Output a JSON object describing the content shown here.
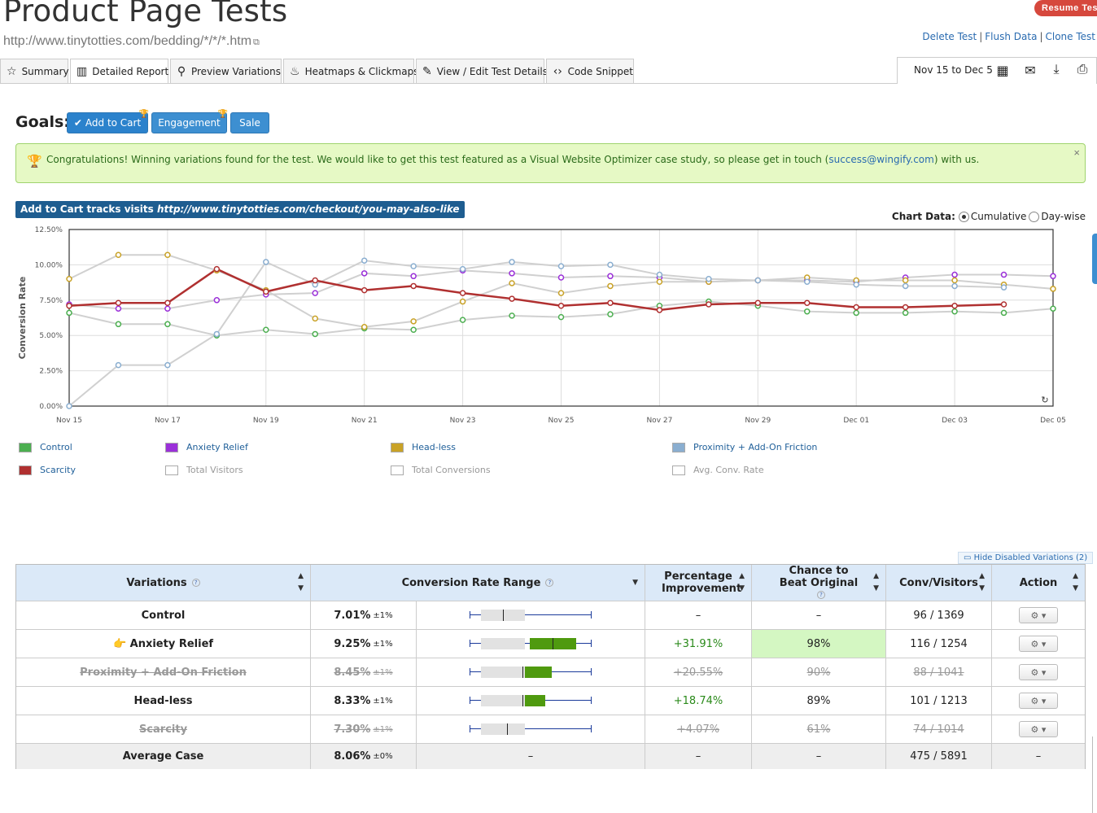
{
  "header": {
    "title": "Product Page Tests",
    "url": "http://www.tinytotties.com/bedding/*/*/*.htm",
    "resume_label": "Resume Test",
    "links": [
      "Delete Test",
      "Flush Data",
      "Clone Test"
    ]
  },
  "tabs": [
    {
      "label": "Summary",
      "icon": "star-icon"
    },
    {
      "label": "Detailed Report",
      "icon": "bar-chart-icon"
    },
    {
      "label": "Preview Variations",
      "icon": "search-icon"
    },
    {
      "label": "Heatmaps & Clickmaps",
      "icon": "flame-icon"
    },
    {
      "label": "View / Edit Test Details",
      "icon": "wrench-icon"
    },
    {
      "label": "Code Snippet",
      "icon": "code-icon"
    }
  ],
  "date_range": "Nov 15 to Dec 5",
  "goals": {
    "label": "Goals:",
    "buttons": [
      "Add to Cart",
      "Engagement",
      "Sale"
    ]
  },
  "alert": {
    "text_before": "Congratulations! Winning variations found for the test. We would like to get this test featured as a Visual Website Optimizer case study, so please get in touch (",
    "email": "success@wingify.com",
    "text_after": ") with us.",
    "close": "×"
  },
  "chart_header": {
    "prefix": "Add to Cart tracks visits ",
    "url": "http://www.tinytotties.com/checkout/you-may-also-like"
  },
  "chart_options": {
    "label": "Chart Data:",
    "cumulative": "Cumulative",
    "daywise": "Day-wise"
  },
  "chart_data": {
    "type": "line",
    "ylabel": "Conversion Rate",
    "ylim": [
      0,
      12.5
    ],
    "yticks": [
      "0.00%",
      "2.50%",
      "5.00%",
      "7.50%",
      "10.00%",
      "12.50%"
    ],
    "xtick_labels": [
      "Nov 15",
      "Nov 17",
      "Nov 19",
      "Nov 21",
      "Nov 23",
      "Nov 25",
      "Nov 27",
      "Nov 29",
      "Dec 01",
      "Dec 03",
      "Dec 05"
    ],
    "x": [
      "Nov 15",
      "Nov 16",
      "Nov 17",
      "Nov 18",
      "Nov 19",
      "Nov 20",
      "Nov 21",
      "Nov 22",
      "Nov 23",
      "Nov 24",
      "Nov 25",
      "Nov 26",
      "Nov 27",
      "Nov 28",
      "Nov 29",
      "Nov 30",
      "Dec 01",
      "Dec 02",
      "Dec 03",
      "Dec 04",
      "Dec 05"
    ],
    "series": [
      {
        "name": "Control",
        "color": "#4caf50",
        "values": [
          6.6,
          5.8,
          5.8,
          5.0,
          5.4,
          5.1,
          5.5,
          5.4,
          6.1,
          6.4,
          6.3,
          6.5,
          7.1,
          7.4,
          7.1,
          6.7,
          6.6,
          6.6,
          6.7,
          6.6,
          6.9
        ]
      },
      {
        "name": "Anxiety Relief",
        "color": "#9b30d9",
        "values": [
          7.2,
          6.9,
          6.9,
          7.5,
          7.9,
          8.0,
          9.4,
          9.2,
          9.6,
          9.4,
          9.1,
          9.2,
          9.1,
          8.8,
          8.9,
          8.9,
          8.8,
          9.1,
          9.3,
          9.3,
          9.2
        ]
      },
      {
        "name": "Head-less",
        "color": "#c9a227",
        "values": [
          9.0,
          10.7,
          10.7,
          9.6,
          8.2,
          6.2,
          5.6,
          6.0,
          7.4,
          8.7,
          8.0,
          8.5,
          8.8,
          8.8,
          8.9,
          9.1,
          8.9,
          8.9,
          8.9,
          8.6,
          8.3
        ]
      },
      {
        "name": "Proximity + Add-On Friction",
        "color": "#8aaed0",
        "values": [
          0.0,
          2.9,
          2.9,
          5.1,
          10.2,
          8.6,
          10.3,
          9.9,
          9.7,
          10.2,
          9.9,
          10.0,
          9.3,
          9.0,
          8.9,
          8.8,
          8.6,
          8.5,
          8.5,
          8.4,
          null
        ]
      },
      {
        "name": "Scarcity",
        "color": "#b03030",
        "values": [
          7.1,
          7.3,
          7.3,
          9.7,
          8.1,
          8.9,
          8.2,
          8.5,
          8.0,
          7.6,
          7.1,
          7.3,
          6.8,
          7.2,
          7.3,
          7.3,
          7.0,
          7.0,
          7.1,
          7.2,
          null
        ]
      }
    ]
  },
  "legend": [
    {
      "label": "Control",
      "color": "#4caf50",
      "on": true
    },
    {
      "label": "Anxiety Relief",
      "color": "#9b30d9",
      "on": true
    },
    {
      "label": "Head-less",
      "color": "#c9a227",
      "on": true
    },
    {
      "label": "Proximity + Add-On Friction",
      "color": "#8aaed0",
      "on": true
    },
    {
      "label": "Scarcity",
      "color": "#b03030",
      "on": true
    },
    {
      "label": "Total Visitors",
      "color": "#ffffff",
      "on": false
    },
    {
      "label": "Total Conversions",
      "color": "#ffffff",
      "on": false
    },
    {
      "label": "Avg. Conv. Rate",
      "color": "#ffffff",
      "on": false
    }
  ],
  "hide_disabled": "Hide Disabled Variations (2)",
  "table": {
    "headers": [
      "Variations",
      "Conversion Rate Range",
      "Percentage Improvement",
      "Chance to Beat Original",
      "Conv/Visitors",
      "Action"
    ],
    "rows": [
      {
        "name": "Control",
        "rate": "7.01%",
        "pm": "±1%",
        "improvement": "–",
        "chance": "–",
        "conv": "96 / 1369",
        "disabled": false,
        "winner": false,
        "range": {
          "box_lo": 6.0,
          "median": 7.01,
          "box_hi": 8.0
        }
      },
      {
        "name": "Anxiety Relief",
        "rate": "9.25%",
        "pm": "±1%",
        "improvement": "+31.91%",
        "chance": "98%",
        "conv": "116 / 1254",
        "disabled": false,
        "winner": true,
        "range": {
          "box_lo": 8.2,
          "median": 9.25,
          "box_hi": 10.3
        }
      },
      {
        "name": "Proximity + Add-On Friction",
        "rate": "8.45%",
        "pm": "±1%",
        "improvement": "+20.55%",
        "chance": "90%",
        "conv": "88 / 1041",
        "disabled": true,
        "winner": false,
        "range": {
          "box_lo": 7.4,
          "median": 7.9,
          "box_hi": 9.2
        }
      },
      {
        "name": "Head-less",
        "rate": "8.33%",
        "pm": "±1%",
        "improvement": "+18.74%",
        "chance": "89%",
        "conv": "101 / 1213",
        "disabled": false,
        "winner": false,
        "range": {
          "box_lo": 7.4,
          "median": 7.9,
          "box_hi": 8.9
        }
      },
      {
        "name": "Scarcity",
        "rate": "7.30%",
        "pm": "±1%",
        "improvement": "+4.07%",
        "chance": "61%",
        "conv": "74 / 1014",
        "disabled": true,
        "winner": false,
        "range": {
          "box_lo": 6.1,
          "median": 7.2,
          "box_hi": 7.9
        }
      }
    ],
    "average": {
      "name": "Average Case",
      "rate": "8.06%",
      "pm": "±0%",
      "range": "–",
      "improvement": "–",
      "chance": "–",
      "conv": "475 / 5891",
      "action": "–"
    }
  }
}
